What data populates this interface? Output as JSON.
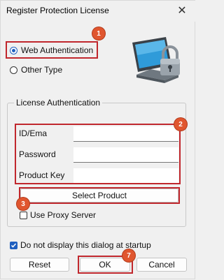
{
  "window": {
    "title": "Register Protection License",
    "close_icon": "close-icon",
    "close_glyph": "✕"
  },
  "auth_type": {
    "options": [
      {
        "label": "Web Authentication",
        "selected": true
      },
      {
        "label": "Other Type",
        "selected": false
      }
    ]
  },
  "license_auth": {
    "group_label": "License Authentication",
    "fields": [
      {
        "label": "ID/Ema",
        "value": ""
      },
      {
        "label": "Password",
        "value": ""
      },
      {
        "label": "Product Key",
        "value": ""
      }
    ],
    "select_product_label": "Select Product",
    "use_proxy": {
      "label": "Use Proxy Server",
      "checked": false
    }
  },
  "startup": {
    "label": "Do not display this dialog at startup",
    "checked": true
  },
  "buttons": {
    "reset": "Reset",
    "ok": "OK",
    "cancel": "Cancel"
  },
  "callouts": [
    "1",
    "2",
    "3",
    "7"
  ],
  "colors": {
    "highlight_red": "#c0272d",
    "badge_orange": "#e0562f",
    "accent_blue": "#1f5fbf"
  },
  "illustration_icon": "monitor-with-padlock-icon"
}
